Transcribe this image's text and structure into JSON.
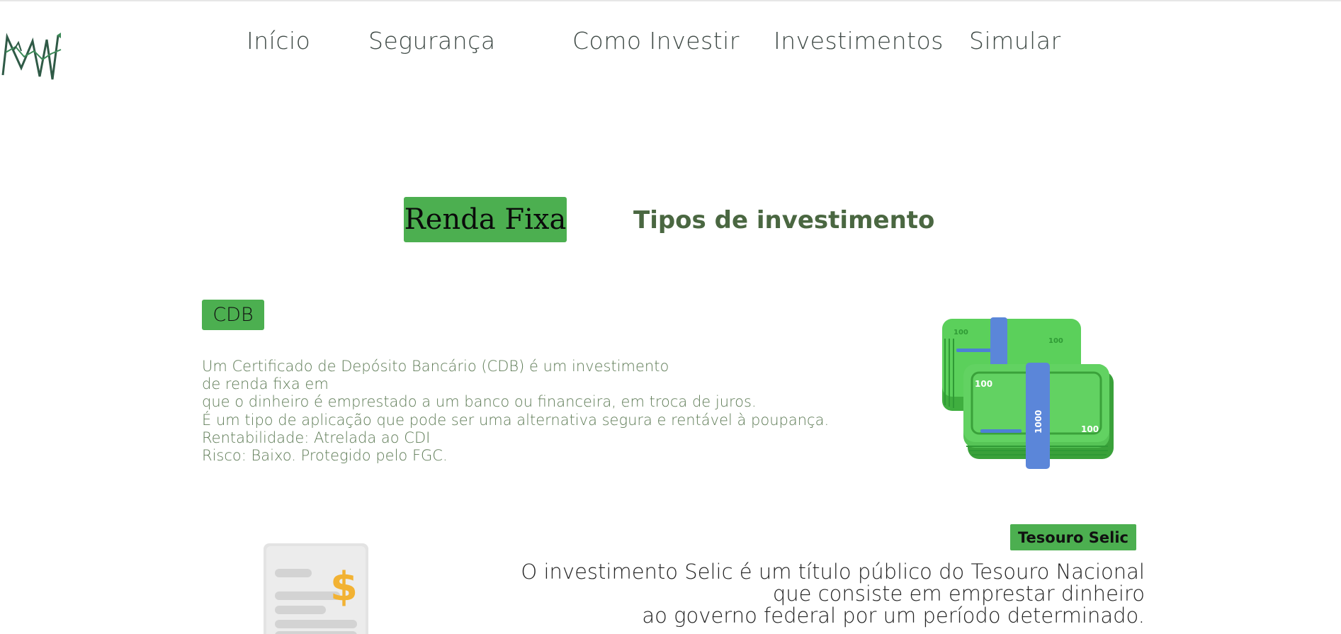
{
  "nav": {
    "items": [
      {
        "label": "Início"
      },
      {
        "label": "Segurança"
      },
      {
        "label": "Como Investir"
      },
      {
        "label": "Investimentos"
      },
      {
        "label": "Simular"
      }
    ]
  },
  "tabs": {
    "active": "Renda Fixa",
    "inactive": "Tipos de investimento"
  },
  "cdb": {
    "badge": "CDB",
    "lines": [
      "Um Certificado de Depósito Bancário (CDB) é um investimento",
      "de renda fixa em",
      "que o dinheiro é emprestado a um banco ou financeira, em troca de juros.",
      "É um tipo de aplicação que pode ser uma alternativa segura e rentável à poupança.",
      "Rentabilidade: Atrelada ao CDI",
      "Risco: Baixo. Protegido pelo FGC."
    ],
    "image_icon": "money-stack-icon",
    "banknote_labels": [
      "100",
      "100",
      "1000",
      "100",
      "100"
    ]
  },
  "selic": {
    "badge": "Tesouro Selic",
    "lines": [
      "O investimento Selic é um título público do Tesouro Nacional",
      "que consiste em emprestar dinheiro",
      "ao governo federal por um período determinado."
    ],
    "image_icon": "document-dollar-icon",
    "currency_symbol": "$"
  },
  "colors": {
    "accent_green": "#4caf50",
    "text_green": "#5f7c57",
    "heading_green": "#4a6741",
    "nav_text": "#3f4a46",
    "logo_green": "#2f5a46"
  }
}
